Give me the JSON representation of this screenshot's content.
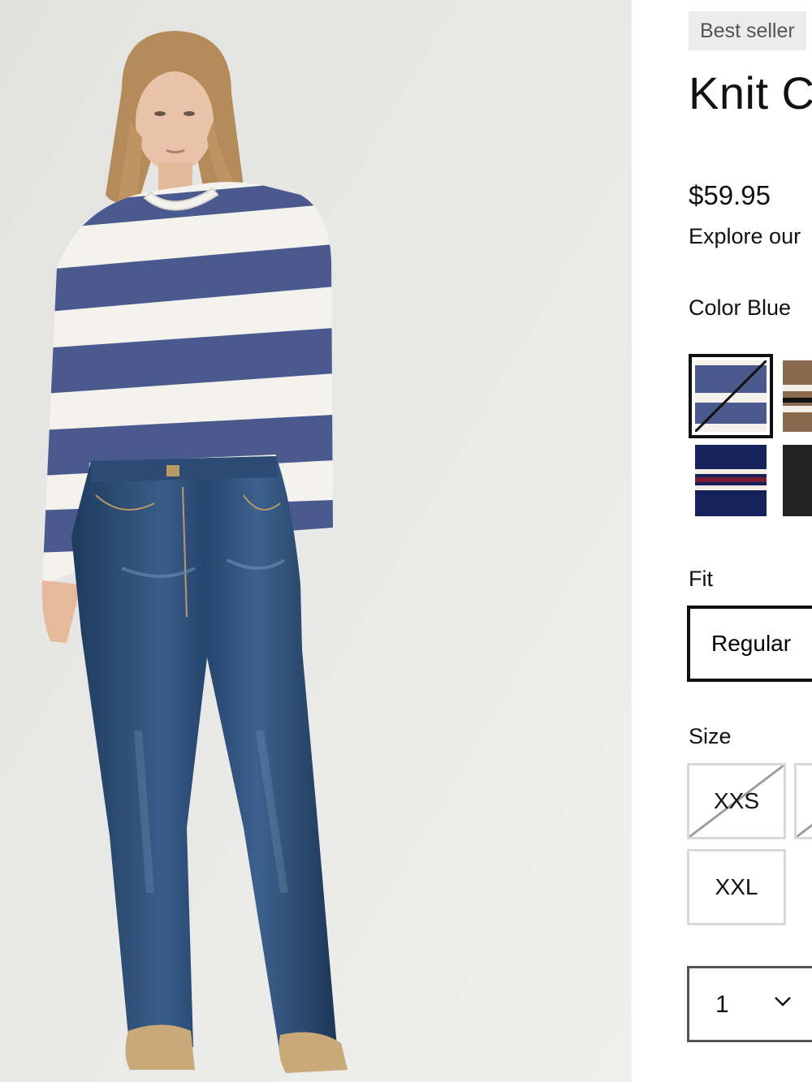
{
  "product": {
    "badge": "Best seller",
    "title": "Knit C",
    "price": "$59.95",
    "promo_text": "Explore our"
  },
  "color": {
    "label": "Color Blue",
    "swatches": [
      {
        "name": "blue-white-stripe",
        "selected": true,
        "unavailable": true
      },
      {
        "name": "brown-stripe",
        "selected": false,
        "unavailable": false
      },
      {
        "name": "navy-stripe",
        "selected": false,
        "unavailable": false
      },
      {
        "name": "black",
        "selected": false,
        "unavailable": false
      }
    ]
  },
  "fit": {
    "label": "Fit",
    "options": [
      "Regular"
    ]
  },
  "size": {
    "label": "Size",
    "options": [
      {
        "label": "XXS",
        "unavailable": true
      },
      {
        "label": "",
        "unavailable": true
      },
      {
        "label": "XXL",
        "unavailable": false
      }
    ]
  },
  "quantity": {
    "value": "1"
  },
  "colors": {
    "stripe_blue": "#4a5a8e",
    "denim": "#27476e",
    "background": "#e9e9e7"
  }
}
